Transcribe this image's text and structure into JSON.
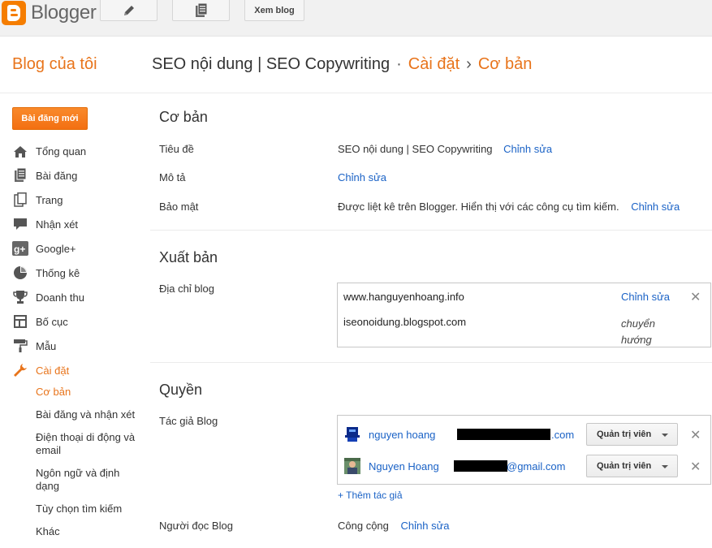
{
  "topbar": {
    "logo_text": "Blogger",
    "edit_icon": "pencil-icon",
    "posts_icon": "document-stack-icon",
    "view_blog_label": "Xem blog"
  },
  "header": {
    "my_blogs": "Blog của tôi",
    "blog_name": "SEO nội dung | SEO Copywriting",
    "dot": "·",
    "settings": "Cài đặt",
    "arrow": "›",
    "basic": "Cơ bản"
  },
  "sidebar": {
    "new_post_label": "Bài đăng mới",
    "items": [
      {
        "label": "Tổng quan",
        "icon": "home-icon"
      },
      {
        "label": "Bài đăng",
        "icon": "posts-icon"
      },
      {
        "label": "Trang",
        "icon": "pages-icon"
      },
      {
        "label": "Nhận xét",
        "icon": "comment-icon"
      },
      {
        "label": "Google+",
        "icon": "google-plus-icon"
      },
      {
        "label": "Thống kê",
        "icon": "pie-chart-icon"
      },
      {
        "label": "Doanh thu",
        "icon": "trophy-icon"
      },
      {
        "label": "Bố cục",
        "icon": "layout-icon"
      },
      {
        "label": "Mẫu",
        "icon": "paint-roller-icon"
      },
      {
        "label": "Cài đặt",
        "icon": "wrench-icon"
      }
    ],
    "sub_items": [
      "Cơ bản",
      "Bài đăng và nhận xét",
      "Điện thoại di động và email",
      "Ngôn ngữ và định dạng",
      "Tùy chọn tìm kiếm",
      "Khác"
    ]
  },
  "basic": {
    "title": "Cơ bản",
    "title_label": "Tiêu đề",
    "title_value": "SEO nội dung | SEO Copywriting",
    "desc_label": "Mô tả",
    "privacy_label": "Bảo mật",
    "privacy_value": "Được liệt kê trên Blogger. Hiển thị với các công cụ tìm kiếm.",
    "edit": "Chỉnh sửa"
  },
  "publishing": {
    "title": "Xuất bản",
    "address_label": "Địa chỉ blog",
    "custom_domain": "www.hanguyenhoang.info",
    "blogspot_domain": "iseonoidung.blogspot.com",
    "redirect_line1": "chuyển",
    "redirect_line2": "hướng",
    "edit": "Chỉnh sửa",
    "remove": "✕"
  },
  "permissions": {
    "title": "Quyền",
    "authors_label": "Tác giả Blog",
    "authors": [
      {
        "name": "nguyen hoang",
        "email_suffix": ".com",
        "role": "Quản trị viên"
      },
      {
        "name": "Nguyen Hoang",
        "email_suffix": "@gmail.com",
        "role": "Quản trị viên"
      }
    ],
    "add_author": "+ Thêm tác giả",
    "readers_label": "Người đọc Blog",
    "readers_value": "Công cộng",
    "edit": "Chỉnh sửa",
    "remove": "✕"
  },
  "colors": {
    "accent": "#e8741b",
    "link": "#1a62c6"
  }
}
